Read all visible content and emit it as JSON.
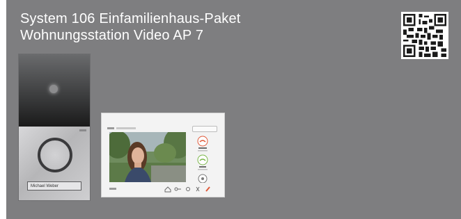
{
  "header": {
    "line1": "System 106 Einfamilienhaus-Paket",
    "line2": "Wohnungsstation Video AP 7"
  },
  "door_station": {
    "name_label": "Michael Weber"
  },
  "colors": {
    "background": "#7e7e80",
    "title_text": "#ffffff",
    "call_accept": "#7ab648",
    "call_reject": "#e05a3a"
  },
  "icons": [
    "qr-code-icon",
    "camera-icon",
    "bell-button-icon",
    "home-icon",
    "key-icon",
    "settings-icon",
    "mute-icon",
    "end-call-icon"
  ]
}
